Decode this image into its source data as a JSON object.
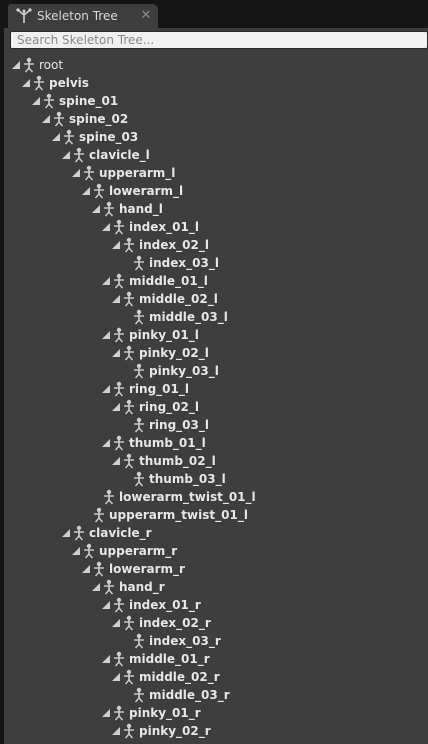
{
  "tab": {
    "title": "Skeleton Tree",
    "icon": "skeleton-tree-icon",
    "close_icon": "close-icon"
  },
  "search": {
    "placeholder": "Search Skeleton Tree...",
    "value": ""
  },
  "colors": {
    "panel_bg": "#3e3e3e",
    "text": "#e6e6e6",
    "toggle": "#cfcfcf"
  },
  "tree": [
    {
      "label": "root",
      "depth": 0,
      "expanded": true,
      "bold": false
    },
    {
      "label": "pelvis",
      "depth": 1,
      "expanded": true,
      "bold": true
    },
    {
      "label": "spine_01",
      "depth": 2,
      "expanded": true,
      "bold": true
    },
    {
      "label": "spine_02",
      "depth": 3,
      "expanded": true,
      "bold": true
    },
    {
      "label": "spine_03",
      "depth": 4,
      "expanded": true,
      "bold": true
    },
    {
      "label": "clavicle_l",
      "depth": 5,
      "expanded": true,
      "bold": true
    },
    {
      "label": "upperarm_l",
      "depth": 6,
      "expanded": true,
      "bold": true
    },
    {
      "label": "lowerarm_l",
      "depth": 7,
      "expanded": true,
      "bold": true
    },
    {
      "label": "hand_l",
      "depth": 8,
      "expanded": true,
      "bold": true
    },
    {
      "label": "index_01_l",
      "depth": 9,
      "expanded": true,
      "bold": true
    },
    {
      "label": "index_02_l",
      "depth": 10,
      "expanded": true,
      "bold": true
    },
    {
      "label": "index_03_l",
      "depth": 11,
      "expanded": null,
      "bold": true
    },
    {
      "label": "middle_01_l",
      "depth": 9,
      "expanded": true,
      "bold": true
    },
    {
      "label": "middle_02_l",
      "depth": 10,
      "expanded": true,
      "bold": true
    },
    {
      "label": "middle_03_l",
      "depth": 11,
      "expanded": null,
      "bold": true
    },
    {
      "label": "pinky_01_l",
      "depth": 9,
      "expanded": true,
      "bold": true
    },
    {
      "label": "pinky_02_l",
      "depth": 10,
      "expanded": true,
      "bold": true
    },
    {
      "label": "pinky_03_l",
      "depth": 11,
      "expanded": null,
      "bold": true
    },
    {
      "label": "ring_01_l",
      "depth": 9,
      "expanded": true,
      "bold": true
    },
    {
      "label": "ring_02_l",
      "depth": 10,
      "expanded": true,
      "bold": true
    },
    {
      "label": "ring_03_l",
      "depth": 11,
      "expanded": null,
      "bold": true
    },
    {
      "label": "thumb_01_l",
      "depth": 9,
      "expanded": true,
      "bold": true
    },
    {
      "label": "thumb_02_l",
      "depth": 10,
      "expanded": true,
      "bold": true
    },
    {
      "label": "thumb_03_l",
      "depth": 11,
      "expanded": null,
      "bold": true
    },
    {
      "label": "lowerarm_twist_01_l",
      "depth": 8,
      "expanded": null,
      "bold": true
    },
    {
      "label": "upperarm_twist_01_l",
      "depth": 7,
      "expanded": null,
      "bold": true
    },
    {
      "label": "clavicle_r",
      "depth": 5,
      "expanded": true,
      "bold": true
    },
    {
      "label": "upperarm_r",
      "depth": 6,
      "expanded": true,
      "bold": true
    },
    {
      "label": "lowerarm_r",
      "depth": 7,
      "expanded": true,
      "bold": true
    },
    {
      "label": "hand_r",
      "depth": 8,
      "expanded": true,
      "bold": true
    },
    {
      "label": "index_01_r",
      "depth": 9,
      "expanded": true,
      "bold": true
    },
    {
      "label": "index_02_r",
      "depth": 10,
      "expanded": true,
      "bold": true
    },
    {
      "label": "index_03_r",
      "depth": 11,
      "expanded": null,
      "bold": true
    },
    {
      "label": "middle_01_r",
      "depth": 9,
      "expanded": true,
      "bold": true
    },
    {
      "label": "middle_02_r",
      "depth": 10,
      "expanded": true,
      "bold": true
    },
    {
      "label": "middle_03_r",
      "depth": 11,
      "expanded": null,
      "bold": true
    },
    {
      "label": "pinky_01_r",
      "depth": 9,
      "expanded": true,
      "bold": true
    },
    {
      "label": "pinky_02_r",
      "depth": 10,
      "expanded": true,
      "bold": true
    }
  ]
}
